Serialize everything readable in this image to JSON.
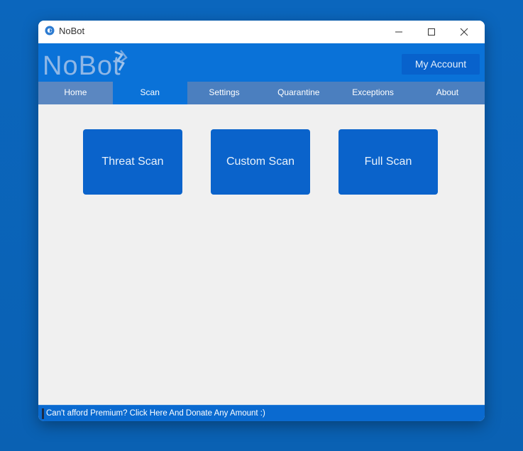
{
  "window": {
    "title": "NoBot",
    "controls": {
      "minimize_icon": "minimize-icon",
      "maximize_icon": "maximize-icon",
      "close_icon": "close-icon"
    }
  },
  "header": {
    "logo_text": "NoBot",
    "account_button": "My Account"
  },
  "tabs": [
    {
      "label": "Home"
    },
    {
      "label": "Scan",
      "active": true
    },
    {
      "label": "Settings"
    },
    {
      "label": "Quarantine"
    },
    {
      "label": "Exceptions"
    },
    {
      "label": "About"
    }
  ],
  "scan": {
    "buttons": [
      {
        "label": "Threat Scan"
      },
      {
        "label": "Custom Scan"
      },
      {
        "label": "Full Scan"
      }
    ]
  },
  "footer": {
    "text": "Can't afford Premium? Click Here And Donate Any Amount :)"
  },
  "colors": {
    "desktop": "#0a63b8",
    "header": "#0a72d8",
    "tabs": "#4b7fbf",
    "button": "#0a63cb",
    "content": "#f0f0f0"
  }
}
